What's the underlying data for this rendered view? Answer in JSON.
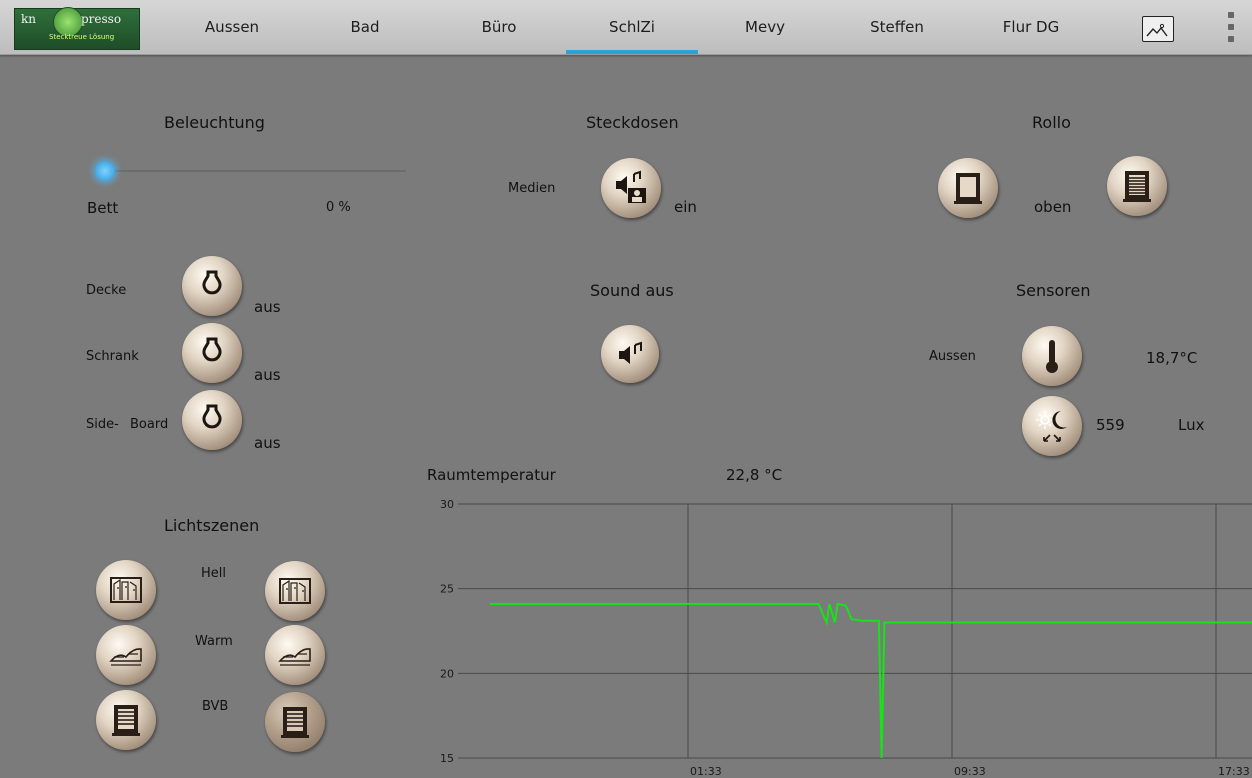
{
  "logo": {
    "text_left": "kn",
    "text_right": "presso",
    "tagline": "Stecktreue Lösung"
  },
  "tabs": [
    {
      "label": "Aussen",
      "active": false
    },
    {
      "label": "Bad",
      "active": false
    },
    {
      "label": "Büro",
      "active": false
    },
    {
      "label": "SchlZi",
      "active": true
    },
    {
      "label": "Mevy",
      "active": false
    },
    {
      "label": "Steffen",
      "active": false
    },
    {
      "label": "Flur DG",
      "active": false
    }
  ],
  "colors": {
    "accent": "#2aa4d8",
    "background": "#7b7b7b",
    "chart_line": "#18e21a"
  },
  "beleuchtung": {
    "title": "Beleuchtung",
    "dimmer": {
      "name": "Bett",
      "value_text": "0 %",
      "level": 0
    },
    "switches": [
      {
        "name": "Decke",
        "state": "aus",
        "icon": "bulb-icon"
      },
      {
        "name": "Schrank",
        "state": "aus",
        "icon": "bulb-icon"
      },
      {
        "name_a": "Side-",
        "name_b": "Board",
        "state": "aus",
        "icon": "bulb-icon"
      }
    ]
  },
  "steckdosen": {
    "title": "Steckdosen",
    "label": "Medien",
    "state": "ein",
    "icon": "media-icon"
  },
  "sound": {
    "title": "Sound aus",
    "icon": "speaker-icon"
  },
  "rollo": {
    "title": "Rollo",
    "state": "oben",
    "icons": [
      "window-up-icon",
      "window-down-icon"
    ]
  },
  "sensoren": {
    "title": "Sensoren",
    "aussen": {
      "label": "Aussen",
      "value": "18,7°C",
      "icon": "thermometer-icon"
    },
    "licht": {
      "value": "559",
      "unit": "Lux",
      "icon": "sun-moon-icon"
    }
  },
  "raumtemperatur": {
    "label": "Raumtemperatur",
    "value": "22,8 °C"
  },
  "lichtszenen": {
    "title": "Lichtszenen",
    "scenes": [
      {
        "name": "Hell",
        "icon": "scene-hell-icon"
      },
      {
        "name": "Warm",
        "icon": "scene-warm-icon"
      },
      {
        "name": "BVB",
        "icon": "scene-bvb-icon"
      }
    ]
  },
  "chart_data": {
    "type": "line",
    "title": "",
    "xlabel": "",
    "ylabel": "",
    "ylim": [
      15,
      30
    ],
    "yticks": [
      15,
      20,
      25,
      30
    ],
    "xticks": [
      "01:33",
      "09:33",
      "17:33"
    ],
    "grid": true,
    "series": [
      {
        "values": [
          {
            "x": "19:33",
            "y": 24.1
          },
          {
            "x": "05:30",
            "y": 24.1
          },
          {
            "x": "05:45",
            "y": 23.0
          },
          {
            "x": "05:50",
            "y": 24.1
          },
          {
            "x": "06:00",
            "y": 23.0
          },
          {
            "x": "06:05",
            "y": 24.1
          },
          {
            "x": "06:20",
            "y": 24.0
          },
          {
            "x": "06:30",
            "y": 23.2
          },
          {
            "x": "06:50",
            "y": 23.1
          },
          {
            "x": "07:20",
            "y": 23.1
          },
          {
            "x": "07:25",
            "y": 15.0
          },
          {
            "x": "07:30",
            "y": 23.0
          },
          {
            "x": "18:40",
            "y": 23.0
          }
        ]
      }
    ]
  }
}
